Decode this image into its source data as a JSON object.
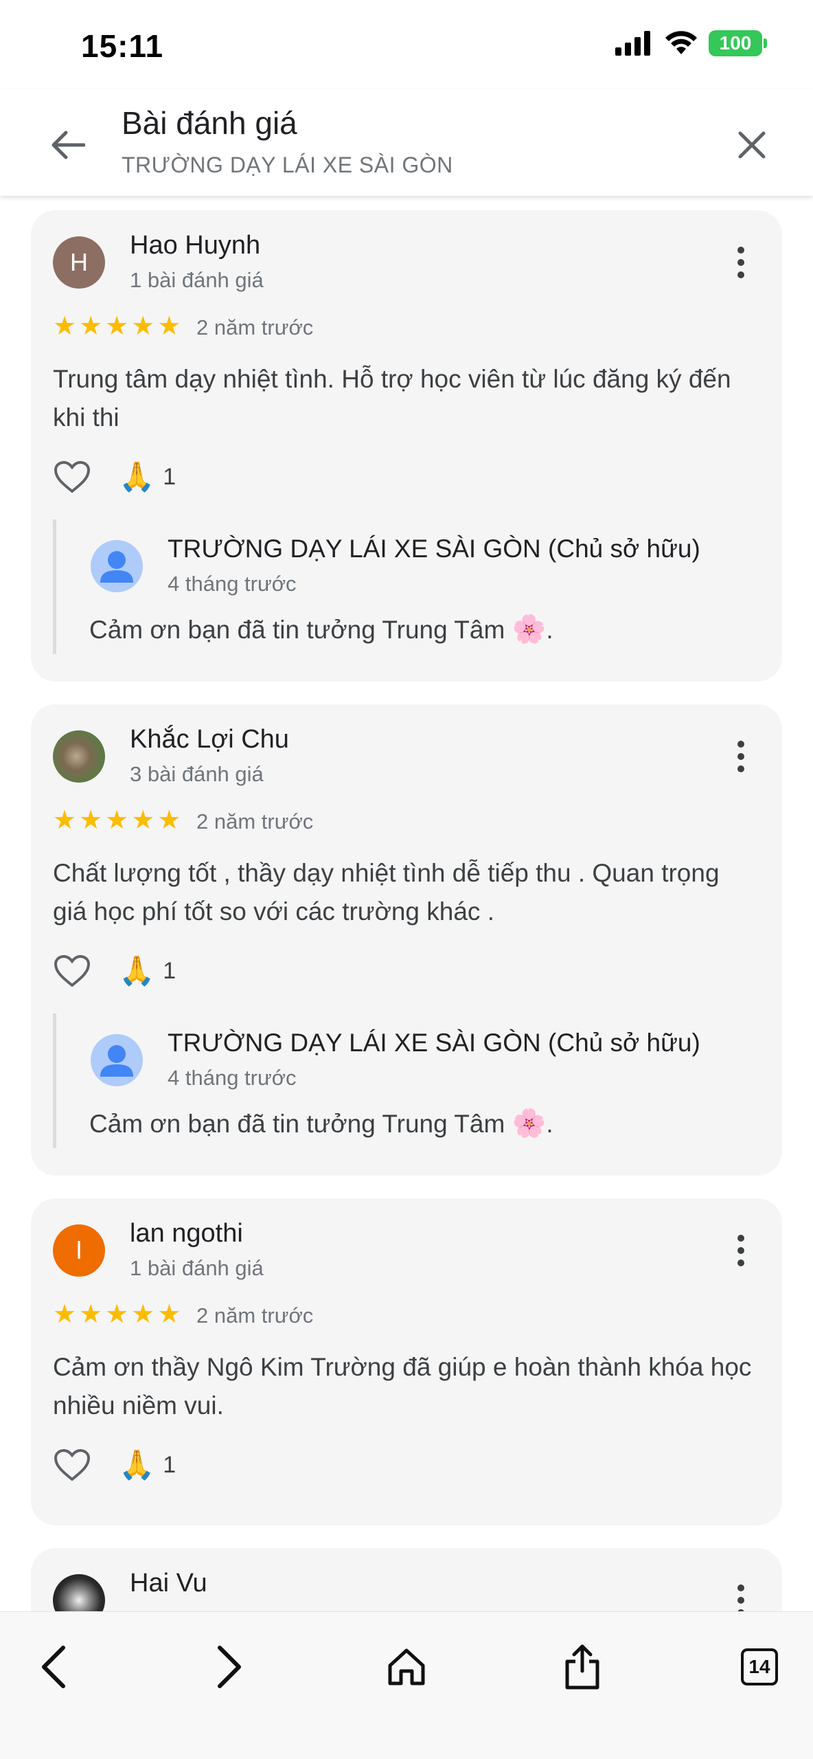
{
  "status_bar": {
    "time": "15:11",
    "battery": "100"
  },
  "header": {
    "title": "Bài đánh giá",
    "subtitle": "TRƯỜNG DẠY LÁI XE SÀI GÒN"
  },
  "reviews": [
    {
      "initial": "H",
      "avatar_color": "#8d6e63",
      "name": "Hao Huynh",
      "review_count": "1 bài đánh giá",
      "rating": 5,
      "time_ago": "2 năm trước",
      "text": "Trung tâm dạy nhiệt tình. Hỗ trợ học viên từ lúc đăng ký đến khi thi",
      "reaction_count": "1",
      "reply": {
        "name": "TRƯỜNG DẠY LÁI XE SÀI GÒN (Chủ sở hữu)",
        "time_ago": "4 tháng trước",
        "text": "Cảm ơn bạn đã tin tưởng Trung Tâm"
      }
    },
    {
      "initial": "",
      "avatar_color": "#6d7f55",
      "name": "Khắc Lợi Chu",
      "review_count": "3 bài đánh giá",
      "rating": 5,
      "time_ago": "2 năm trước",
      "text": "Chất lượng tốt , thầy dạy nhiệt tình dễ tiếp thu . Quan trọng giá học phí tốt so với các trường khác .",
      "reaction_count": "1",
      "reply": {
        "name": "TRƯỜNG DẠY LÁI XE SÀI GÒN (Chủ sở hữu)",
        "time_ago": "4 tháng trước",
        "text": "Cảm ơn bạn đã tin tưởng Trung Tâm"
      }
    },
    {
      "initial": "l",
      "avatar_color": "#ef6c00",
      "name": "lan ngothi",
      "review_count": "1 bài đánh giá",
      "rating": 5,
      "time_ago": "2 năm trước",
      "text": "Cảm ơn thầy Ngô Kim Trường đã giúp e hoàn thành khóa học nhiều niềm vui.",
      "reaction_count": "1"
    },
    {
      "initial": "",
      "avatar_color": "#3a3a3a",
      "name": "Hai Vu"
    }
  ],
  "bottom_bar": {
    "tab_count": "14"
  },
  "colors": {
    "star": "#fbbc04",
    "card_bg": "#f5f5f5",
    "reply_avatar": "#aecbfa",
    "accent_blue": "#4285f4"
  }
}
